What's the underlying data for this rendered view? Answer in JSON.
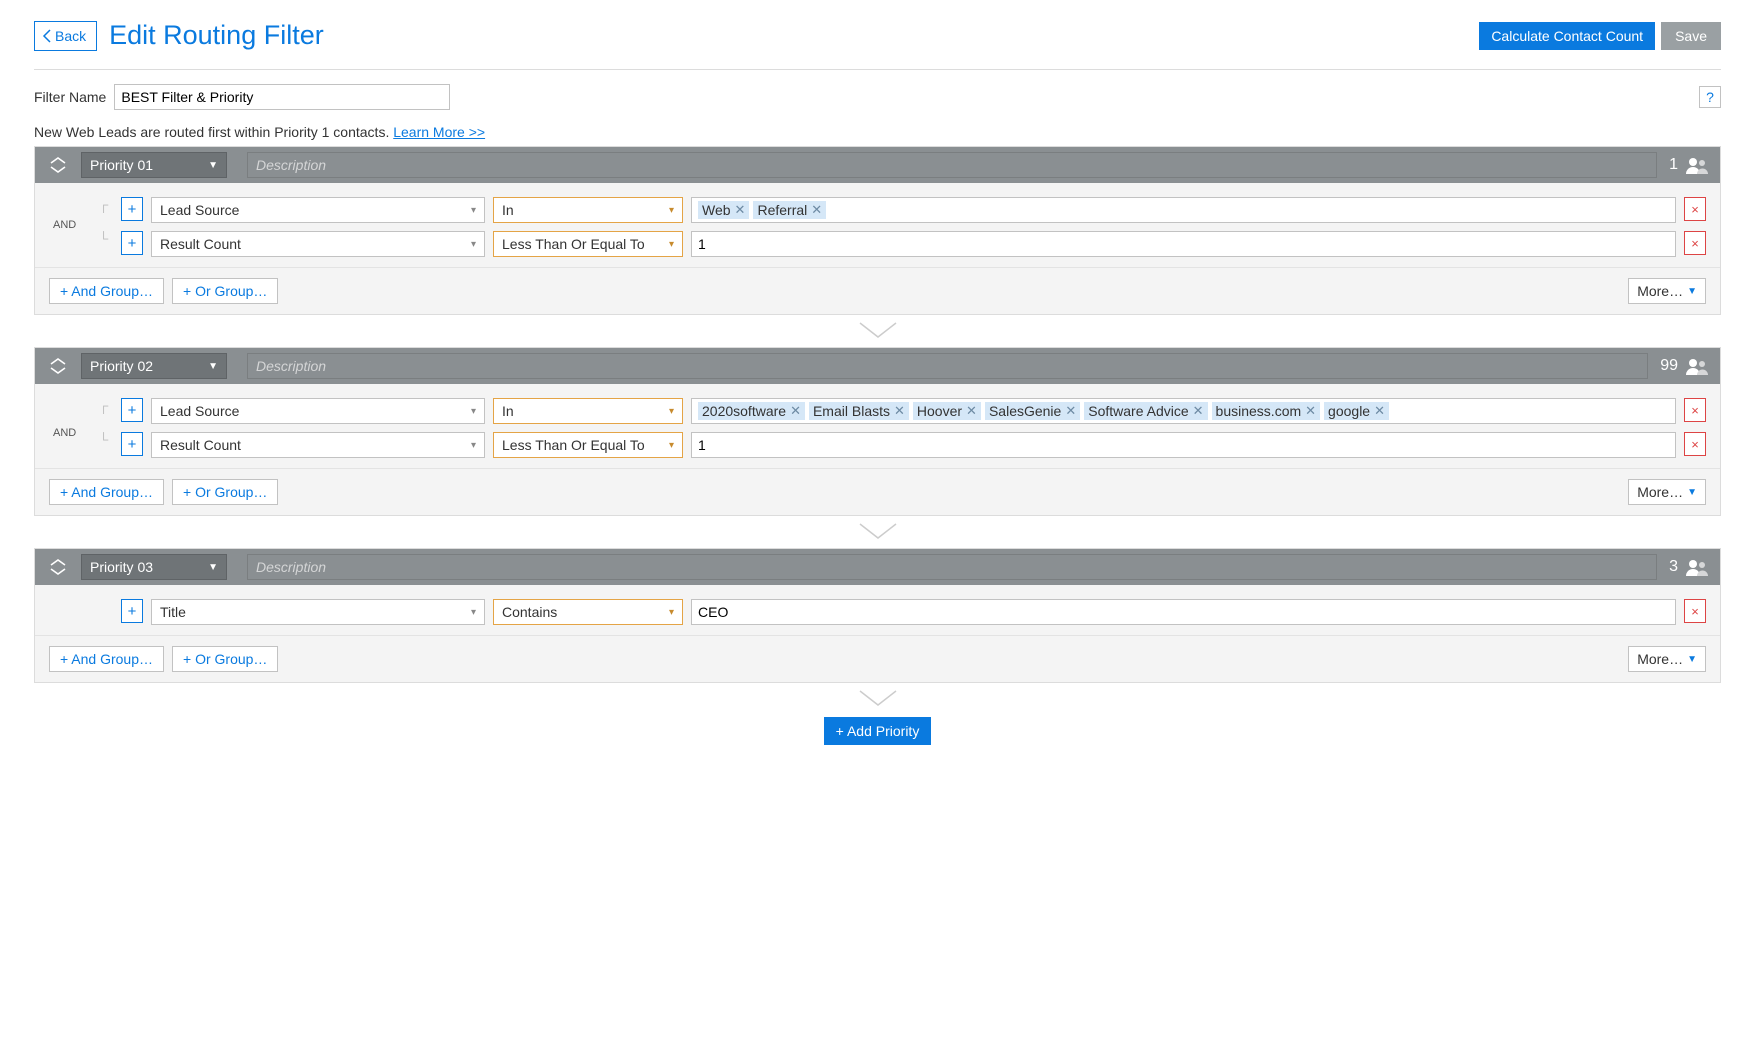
{
  "header": {
    "back": "Back",
    "title": "Edit Routing Filter",
    "calc": "Calculate Contact Count",
    "save": "Save"
  },
  "filterNameLabel": "Filter Name",
  "filterNameValue": "BEST Filter & Priority",
  "hintText": "New Web Leads are routed first within Priority 1 contacts. ",
  "hintLink": "Learn More >>",
  "helpQ": "?",
  "descPlaceholder": "Description",
  "andLabel": "AND",
  "buttons": {
    "andGroup": "+ And Group…",
    "orGroup": "+ Or Group…",
    "more": "More…",
    "addPriority": "+ Add Priority"
  },
  "prio1": {
    "label": "Priority 01",
    "count": "1",
    "r1_field": "Lead Source",
    "r1_op": "In",
    "r1_tags": {
      "0": "Web",
      "1": "Referral"
    },
    "r2_field": "Result Count",
    "r2_op": "Less Than Or Equal To",
    "r2_val": "1"
  },
  "prio2": {
    "label": "Priority 02",
    "count": "99",
    "r1_field": "Lead Source",
    "r1_op": "In",
    "r1_tags": {
      "0": "2020software",
      "1": "Email Blasts",
      "2": "Hoover",
      "3": "SalesGenie",
      "4": "Software Advice",
      "5": "business.com",
      "6": "google"
    },
    "r2_field": "Result Count",
    "r2_op": "Less Than Or Equal To",
    "r2_val": "1"
  },
  "prio3": {
    "label": "Priority 03",
    "count": "3",
    "r1_field": "Title",
    "r1_op": "Contains",
    "r1_val": "CEO"
  }
}
